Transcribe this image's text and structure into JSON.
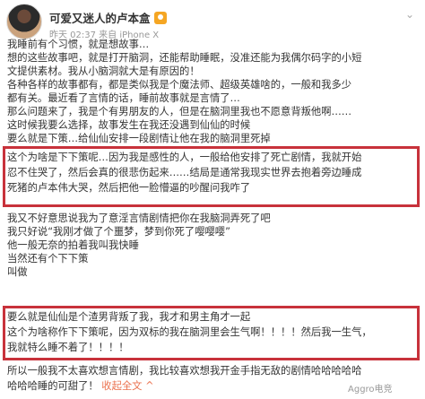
{
  "post": {
    "username": "可爱又迷人的卢本盒",
    "meta": "昨天 02:37 来自 iPhone X",
    "lines": [
      "我睡前有个习惯，就是想故事…",
      "想的这些故事吧，就是打开脑洞，还能帮助睡眠，没准还能为我偶尔码字的小短",
      "文提供素材。我从小脑洞就大是有原因的！",
      "各种各样的故事都有，都是类似我是个魔法师、超级英雄啥的，一般和我多少",
      "都有关。最近看了言情的话，睡前故事就是言情了…",
      "那么问题来了，我是个有男朋友的人，但是在脑洞里我也不愿意背叛他啊……",
      "这时候我要么选择，故事发生在我还没遇到仙仙的时候",
      "要么就是下策…给仙仙安排一段剧情让他在我的脑洞里死掉",
      "这个为啥是下下策呢…因为我是感性的人，一般给他安排了死亡剧情，我就开始",
      "忍不住哭了，然后会真的很悲伤起来……结局是通常我现实世界去抱着旁边睡成",
      "死猪的卢本伟大哭，然后把他一脸懵逼的吵醒问我咋了",
      "我又不好意思说我为了意淫言情剧情把你在我脑洞弄死了吧",
      "我只好说“我刚才做了个噩梦，梦到你死了嘤嘤嘤”",
      "他一般无奈的拍着我叫我快睡",
      "当然还有个下下策",
      "叫做",
      "要么就是仙仙是个渣男背叛了我，我才和男主角才一起",
      "这个为啥称作下下策呢，因为双标的我在脑洞里会生气啊！！！！然后我一生气，",
      "我就特么睡不着了！！！！",
      "所以一般我不太喜欢想言情剧，我比较喜欢想我开金手指无敌的剧情哈哈哈哈哈",
      "哈哈哈睡的可甜了！"
    ],
    "expand_label": "收起全文",
    "expand_arrow": "^",
    "watermark": "Aggro电竞"
  }
}
